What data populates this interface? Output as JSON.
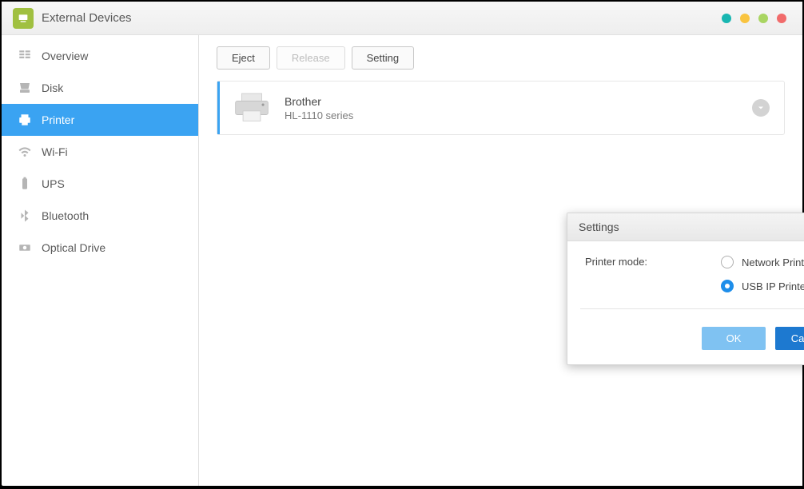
{
  "title": "External Devices",
  "sidebar": {
    "items": [
      {
        "label": "Overview",
        "icon": "overview-icon"
      },
      {
        "label": "Disk",
        "icon": "disk-icon"
      },
      {
        "label": "Printer",
        "icon": "printer-icon",
        "active": true
      },
      {
        "label": "Wi-Fi",
        "icon": "wifi-icon"
      },
      {
        "label": "UPS",
        "icon": "ups-icon"
      },
      {
        "label": "Bluetooth",
        "icon": "bluetooth-icon"
      },
      {
        "label": "Optical Drive",
        "icon": "optical-icon"
      }
    ]
  },
  "toolbar": {
    "eject": "Eject",
    "release": "Release",
    "setting": "Setting"
  },
  "device": {
    "name": "Brother",
    "model": "HL-1110 series"
  },
  "modal": {
    "title": "Settings",
    "printer_mode_label": "Printer mode:",
    "option_network": "Network Printer",
    "option_usbip": "USB IP Printer",
    "selected": "usbip",
    "ok_label": "OK",
    "cancel_label": "Cancel"
  },
  "colors": {
    "accent": "#3aa3f2"
  }
}
